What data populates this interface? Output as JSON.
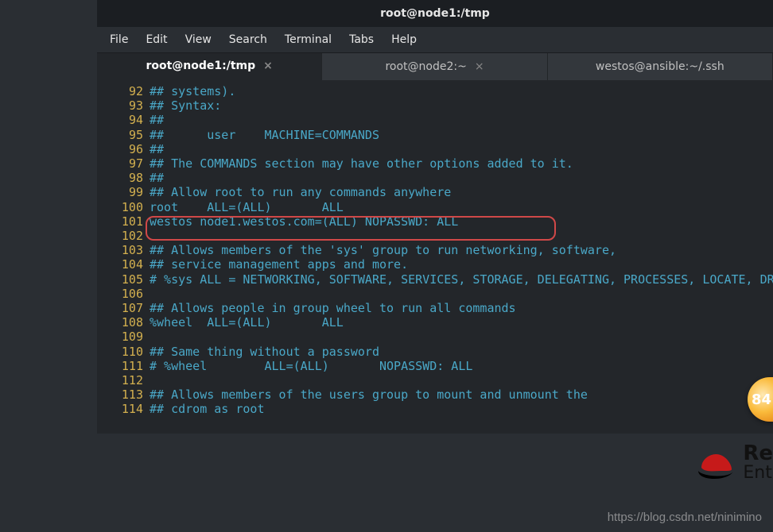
{
  "window": {
    "title": "root@node1:/tmp"
  },
  "menu": {
    "file": "File",
    "edit": "Edit",
    "view": "View",
    "search": "Search",
    "terminal": "Terminal",
    "tabs": "Tabs",
    "help": "Help"
  },
  "tabs": [
    {
      "label": "root@node1:/tmp",
      "active": true
    },
    {
      "label": "root@node2:~",
      "active": false
    },
    {
      "label": "westos@ansible:~/.ssh",
      "active": false
    }
  ],
  "lines": [
    {
      "n": "92",
      "t": "## systems)."
    },
    {
      "n": "93",
      "t": "## Syntax:"
    },
    {
      "n": "94",
      "t": "##"
    },
    {
      "n": "95",
      "t": "##      user    MACHINE=COMMANDS"
    },
    {
      "n": "96",
      "t": "##"
    },
    {
      "n": "97",
      "t": "## The COMMANDS section may have other options added to it."
    },
    {
      "n": "98",
      "t": "##"
    },
    {
      "n": "99",
      "t": "## Allow root to run any commands anywhere"
    },
    {
      "n": "100",
      "t": "root    ALL=(ALL)       ALL"
    },
    {
      "n": "101",
      "t": "westos node1.westos.com=(ALL) NOPASSWD: ALL"
    },
    {
      "n": "102",
      "t": ""
    },
    {
      "n": "103",
      "t": "## Allows members of the 'sys' group to run networking, software,"
    },
    {
      "n": "104",
      "t": "## service management apps and more."
    },
    {
      "n": "105",
      "t": "# %sys ALL = NETWORKING, SOFTWARE, SERVICES, STORAGE, DELEGATING, PROCESSES, LOCATE, DRIVERS"
    },
    {
      "n": "106",
      "t": ""
    },
    {
      "n": "107",
      "t": "## Allows people in group wheel to run all commands"
    },
    {
      "n": "108",
      "t": "%wheel  ALL=(ALL)       ALL"
    },
    {
      "n": "109",
      "t": ""
    },
    {
      "n": "110",
      "t": "## Same thing without a password"
    },
    {
      "n": "111",
      "t": "# %wheel        ALL=(ALL)       NOPASSWD: ALL"
    },
    {
      "n": "112",
      "t": ""
    },
    {
      "n": "113",
      "t": "## Allows members of the users group to mount and unmount the"
    },
    {
      "n": "114",
      "t": "## cdrom as root"
    }
  ],
  "badge": {
    "value": "84"
  },
  "logo": {
    "line1": "Re",
    "line2": "Ent"
  },
  "watermark": "https://blog.csdn.net/ninimino"
}
